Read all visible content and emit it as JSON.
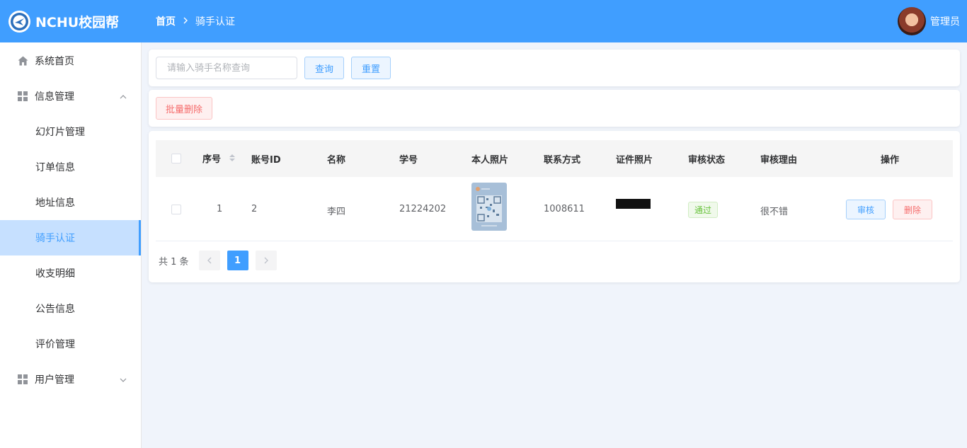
{
  "app": {
    "title": "NCHU校园帮",
    "logo_icon": "bird-logo-icon",
    "accent": "#409eff"
  },
  "breadcrumb": {
    "home": "首页",
    "current": "骑手认证"
  },
  "user": {
    "name": "管理员",
    "avatar_icon": "user-avatar"
  },
  "sidebar": {
    "home": "系统首页",
    "info_group": "信息管理",
    "info_items": [
      "幻灯片管理",
      "订单信息",
      "地址信息",
      "骑手认证",
      "收支明细",
      "公告信息",
      "评价管理"
    ],
    "active_item": "骑手认证",
    "user_group": "用户管理"
  },
  "search": {
    "placeholder": "请输入骑手名称查询",
    "value": "",
    "query_label": "查询",
    "reset_label": "重置"
  },
  "actions": {
    "batch_delete_label": "批量删除"
  },
  "table": {
    "columns": [
      "序号",
      "账号ID",
      "名称",
      "学号",
      "本人照片",
      "联系方式",
      "证件照片",
      "审核状态",
      "审核理由",
      "操作"
    ],
    "rows": [
      {
        "index": "1",
        "account_id": "2",
        "name": "李四",
        "student_no": "21224202",
        "photo": "qr-code-image",
        "contact": "1008611",
        "id_photo": "id-card-image",
        "status": "通过",
        "reason": "很不错",
        "review_label": "审核",
        "delete_label": "删除"
      }
    ]
  },
  "pagination": {
    "total_text": "共 1 条",
    "current_page": "1"
  },
  "colors": {
    "primary": "#409eff",
    "danger": "#f56c6c",
    "success": "#67c23a",
    "background": "#f0f4fb"
  }
}
